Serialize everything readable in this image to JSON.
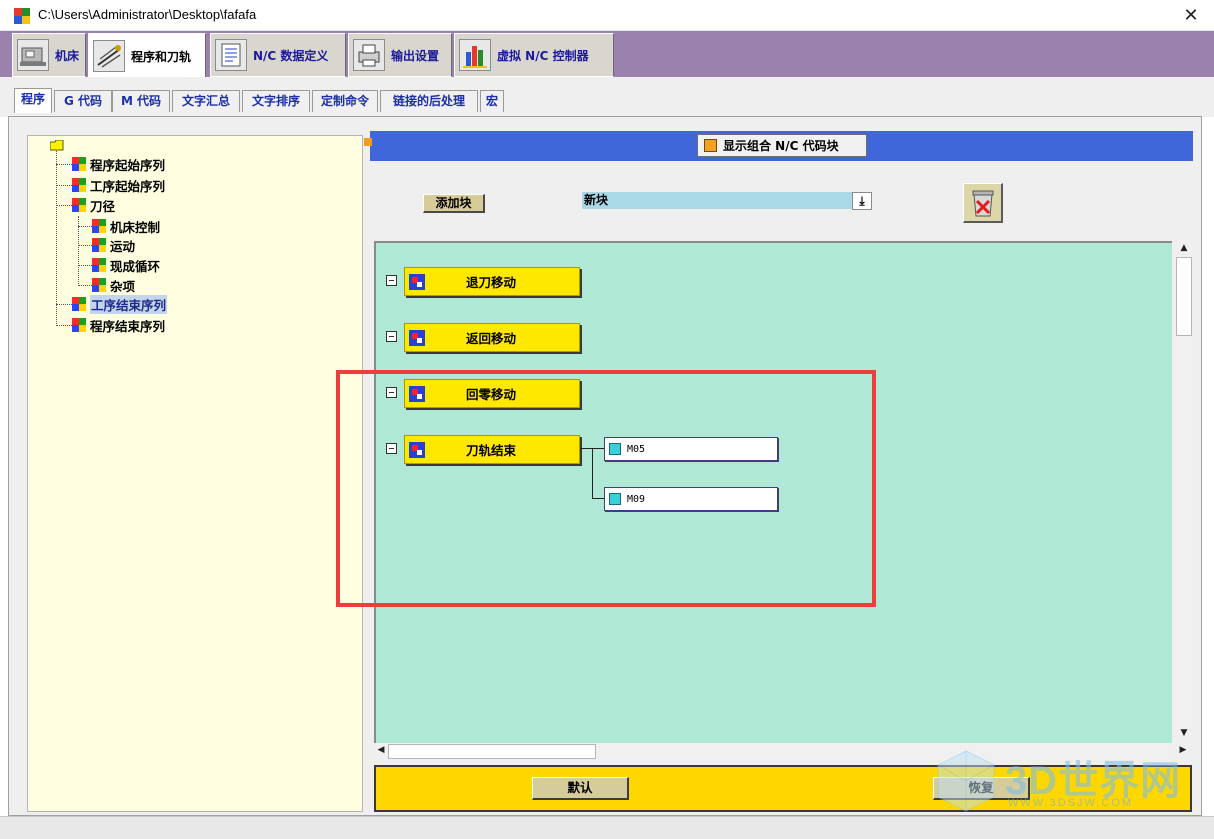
{
  "window": {
    "title": "C:\\Users\\Administrator\\Desktop\\fafafa",
    "close_glyph": "✕"
  },
  "main_tabs": [
    {
      "label": "机床",
      "icon": "machine-icon"
    },
    {
      "label": "程序和刀轨",
      "icon": "program-toolpath-icon",
      "active": true
    },
    {
      "label": "N/C 数据定义",
      "icon": "nc-data-icon"
    },
    {
      "label": "输出设置",
      "icon": "printer-icon"
    },
    {
      "label": "虚拟 N/C 控制器",
      "icon": "virtual-controller-icon"
    }
  ],
  "sub_tabs": [
    {
      "label": "程序",
      "active": true
    },
    {
      "label": "G 代码"
    },
    {
      "label": "M 代码"
    },
    {
      "label": "文字汇总"
    },
    {
      "label": "文字排序"
    },
    {
      "label": "定制命令"
    },
    {
      "label": "链接的后处理"
    },
    {
      "label": "宏"
    }
  ],
  "tree": {
    "root_icon": "folder-icon",
    "nodes": [
      {
        "label": "程序起始序列",
        "level": 1
      },
      {
        "label": "工序起始序列",
        "level": 1
      },
      {
        "label": "刀径",
        "level": 1
      },
      {
        "label": "机床控制",
        "level": 2
      },
      {
        "label": "运动",
        "level": 2
      },
      {
        "label": "现成循环",
        "level": 2
      },
      {
        "label": "杂项",
        "level": 2
      },
      {
        "label": "工序结束序列",
        "level": 1,
        "selected": true
      },
      {
        "label": "程序结束序列",
        "level": 1
      }
    ]
  },
  "toolbar": {
    "show_combined_label": "显示组合 N/C 代码块",
    "add_block_label": "添加块",
    "new_block_value": "新块",
    "dropdown_glyph": "⤓"
  },
  "blocks": [
    {
      "label": "退刀移动"
    },
    {
      "label": "返回移动"
    },
    {
      "label": "回零移动"
    },
    {
      "label": "刀轨结束",
      "children": [
        "M05",
        "M09"
      ]
    }
  ],
  "buttons": {
    "default_label": "默认",
    "restore_label": "恢复"
  },
  "watermark": {
    "big": "3D世界网",
    "small": "WWW.3DSJW.COM"
  },
  "colors": {
    "accent_purple": "#9b82ae",
    "header_blue": "#3f67d9",
    "canvas": "#b0e8d6",
    "block_yellow": "#ffe800",
    "footer_yellow": "#ffd700",
    "highlight_red": "#ee3d3d"
  }
}
